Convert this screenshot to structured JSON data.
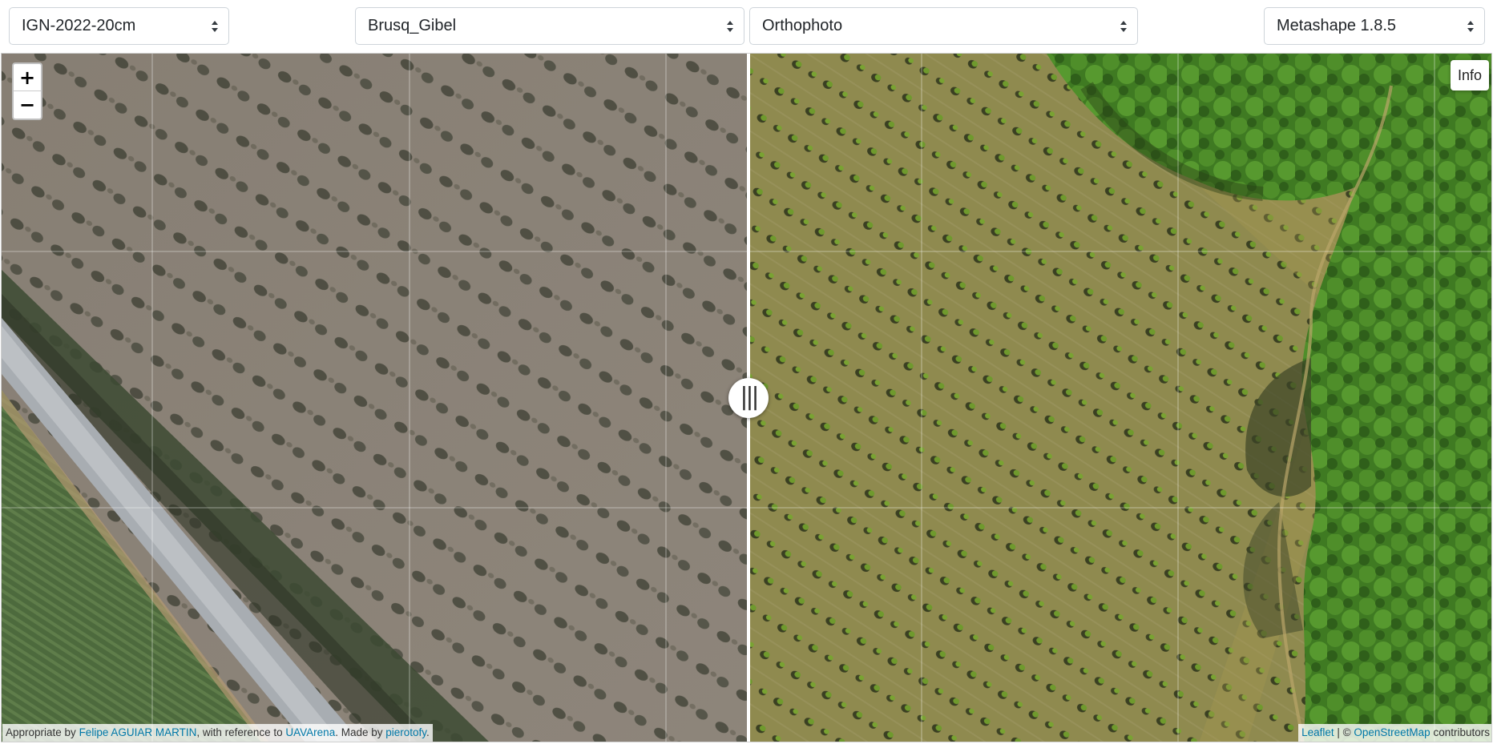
{
  "toolbar": {
    "reference_select": {
      "value": "IGN-2022-20cm"
    },
    "site_select": {
      "value": "Brusq_Gibel"
    },
    "product_select": {
      "value": "Orthophoto"
    },
    "software_select": {
      "value": "Metashape 1.8.5"
    }
  },
  "map": {
    "zoom_in_label": "+",
    "zoom_out_label": "−",
    "info_label": "Info",
    "splitter_label": "|||",
    "left_image": "IGN orthophoto tile (grey olive orchard rows, road, crop field)",
    "right_image": "UAV orthophoto tile (olive rows on dry grass, green woodland)"
  },
  "attribution_left": {
    "prefix": "Appropriate by ",
    "author": "Felipe AGUIAR MARTIN",
    "middle": ", with reference to ",
    "project": "UAVArena",
    "made_by": ". Made by ",
    "maker": "pierotofy",
    "suffix": "."
  },
  "attribution_right": {
    "leaflet": "Leaflet",
    "sep": " | © ",
    "osm": "OpenStreetMap",
    "suffix": " contributors"
  },
  "colors": {
    "left_ground": "#8a8176",
    "right_ground": "#8e8a4c",
    "tree_dark": "#3b3e2e",
    "tree_green": "#5e8a2a",
    "forest": "#3f7a22",
    "link": "#0078a8"
  }
}
